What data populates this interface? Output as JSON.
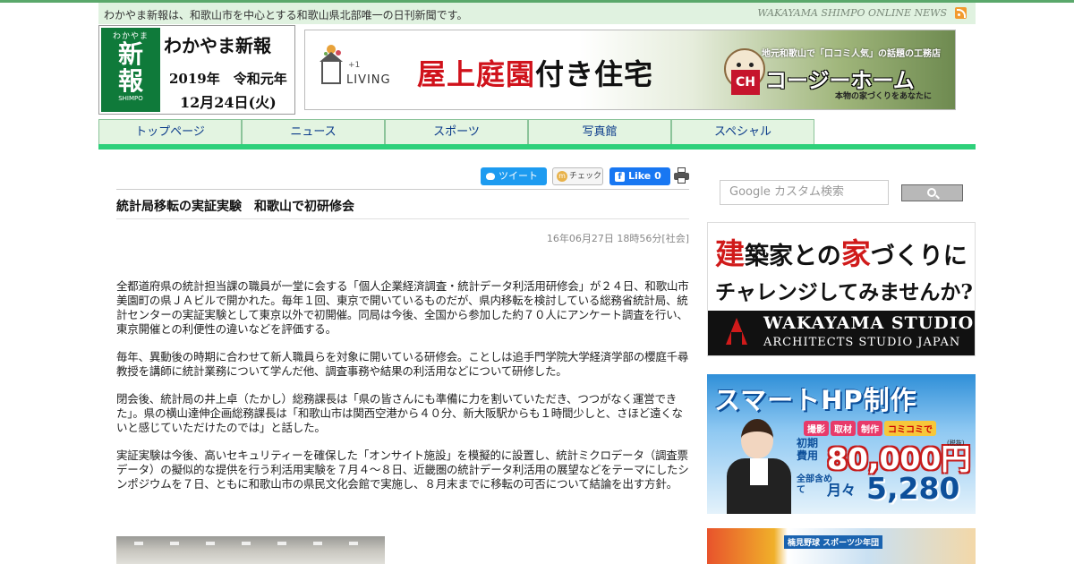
{
  "site": {
    "tagline": "わかやま新報は、和歌山市を中心とする和歌山県北部唯一の日刊新聞です。",
    "online_label": "WAKAYAMA SHIMPO ONLINE NEWS",
    "rss_icon": "rss-icon"
  },
  "logo": {
    "mark_small": "わかやま",
    "mark_big_1": "新",
    "mark_big_2": "報",
    "mark_en": "SHIMPO",
    "name": "わかやま新報",
    "year": "2019年　令和元年",
    "date": "12月24日(火)"
  },
  "header_ad": {
    "logo_plus": "+1",
    "logo_text": "LIVING",
    "headline_red": "屋上庭園",
    "headline_black": "付き住宅",
    "sub_top": "地元和歌山で「口コミ人気」の話題の工務店",
    "brand_mark": "CH",
    "brand": "コージーホーム",
    "sub_bottom": "本物の家づくりをあなたに"
  },
  "nav": {
    "items": [
      "トップページ",
      "ニュース",
      "スポーツ",
      "写真館",
      "スペシャル"
    ]
  },
  "social": {
    "tweet": "ツイート",
    "check": "チェック",
    "like": "Like 0"
  },
  "article": {
    "title": "統計局移転の実証実験　和歌山で初研修会",
    "dateline": "16年06月27日 18時56分[社会]",
    "paragraphs": [
      "全都道府県の統計担当課の職員が一堂に会する「個人企業経済調査・統計データ利活用研修会」が２４日、和歌山市美園町の県ＪＡビルで開かれた。毎年１回、東京で開いているものだが、県内移転を検討している総務省統計局、統計センターの実証実験として東京以外で初開催。同局は今後、全国から参加した約７０人にアンケート調査を行い、東京開催との利便性の違いなどを評価する。",
      "毎年、異動後の時期に合わせて新人職員らを対象に開いている研修会。ことしは追手門学院大学経済学部の櫻庭千尋教授を講師に統計業務について学んだ他、調査事務や結果の利活用などについて研修した。",
      "閉会後、統計局の井上卓（たかし）総務課長は「県の皆さんにも準備に力を割いていただき、つつがなく運営できた」。県の横山達伸企画総務課長は「和歌山市は関西空港から４０分、新大阪駅からも１時間少しと、さほど遠くないと感じていただけたのでは」と話した。",
      "実証実験は今後、高いセキュリティーを確保した「オンサイト施設」を模擬的に設置し、統計ミクロデータ（調査票データ）の擬似的な提供を行う利活用実験を７月４～８日、近畿圏の統計データ利活用の展望などをテーマにしたシンポジウムを７日、ともに和歌山市の県民文化会館で実施し、８月末までに移転の可否について結論を出す方針。"
    ]
  },
  "sidebar": {
    "search_placeholder": "Google カスタム検索",
    "ad1": {
      "line1_a": "建",
      "line1_b": "築家との",
      "line1_c": "家",
      "line1_d": "づくりに",
      "line2": "チャレンジしてみませんか?",
      "studio": "WAKAYAMA STUDIO",
      "studio_sub": "ARCHITECTS STUDIO JAPAN"
    },
    "ad2": {
      "headline": "スマートHP制作",
      "tag1": "撮影",
      "tag2": "取材",
      "tag3": "制作",
      "tag4": "コミコミで",
      "initial_label": "初期費用",
      "initial_price": "80,000円",
      "tax1": "(税抜)",
      "monthly_label": "全部含めて",
      "monthly_word": "月々",
      "monthly_price": "5,280円"
    },
    "ad3": {
      "text": "楠見野球 スポーツ少年団"
    }
  },
  "colors": {
    "nav_bg": "#e3f4e1",
    "nav_accent": "#2ed07a",
    "tagbar_bg": "#e0f2e0",
    "logo_green": "#0f7a3a",
    "headline_red": "#d0121b"
  }
}
